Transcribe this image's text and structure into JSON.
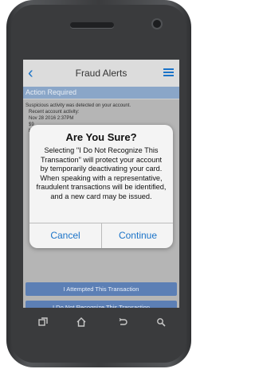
{
  "header": {
    "title": "Fraud Alerts",
    "back_icon": "back-chevron-icon",
    "menu_icon": "hamburger-menu-icon"
  },
  "banner": {
    "label": "Action Required"
  },
  "message": {
    "line1": "Suspicious activity was detected on your account.",
    "line2": "Recent account activity:",
    "line3": "Nov 28 2016  2:37PM",
    "line4": "$9",
    "line5": "M"
  },
  "dialog": {
    "title": "Are You Sure?",
    "body": "Selecting \"I Do Not Recognize This Transaction\" will protect your account by temporarily deactivating your card. When speaking with a representative, fraudulent transactions will be identified, and a new card may be issued.",
    "cancel_label": "Cancel",
    "continue_label": "Continue"
  },
  "actions": {
    "attempted_label": "I Attempted This Transaction",
    "not_recognize_label": "I Do Not Recognize This Transaction"
  },
  "colors": {
    "accent": "#1a73c8",
    "banner": "#8aa6c8",
    "action_button": "#5c7fb5"
  },
  "nav": {
    "icons": [
      "recent-apps-icon",
      "home-icon",
      "back-icon",
      "search-icon"
    ]
  }
}
